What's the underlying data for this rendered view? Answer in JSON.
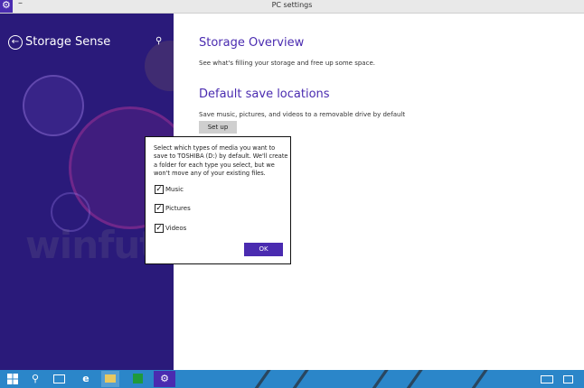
{
  "window": {
    "title": "PC settings",
    "minimize_glyph": "–",
    "app_icon": "gear-icon"
  },
  "sidebar": {
    "back_icon": "back-arrow-icon",
    "title": "Storage Sense",
    "search_icon": "search-icon"
  },
  "watermark": "winfuture",
  "main": {
    "storage_overview": {
      "title": "Storage Overview",
      "desc": "See what's filling your storage and free up some space."
    },
    "default_save": {
      "title": "Default save locations",
      "desc": "Save music, pictures, and videos to a removable drive by default",
      "button": "Set up"
    }
  },
  "dialog": {
    "text": "Select which types of media you want to save to TOSHIBA (D:) by default. We'll create a folder for each type you select, but we won't move any of your existing files.",
    "options": [
      {
        "label": "Music",
        "checked": true
      },
      {
        "label": "Pictures",
        "checked": true
      },
      {
        "label": "Videos",
        "checked": true
      }
    ],
    "ok": "OK"
  },
  "taskbar": {
    "items": [
      "windows-logo-icon",
      "search-icon",
      "task-view-icon",
      "internet-explorer-icon",
      "file-explorer-icon",
      "store-icon",
      "settings-icon"
    ],
    "tray": [
      "keyboard-icon",
      "notifications-icon"
    ]
  },
  "colors": {
    "accent": "#4a2bb0",
    "sidebar": "#2a1a7a",
    "taskbar": "#2b86c9"
  }
}
